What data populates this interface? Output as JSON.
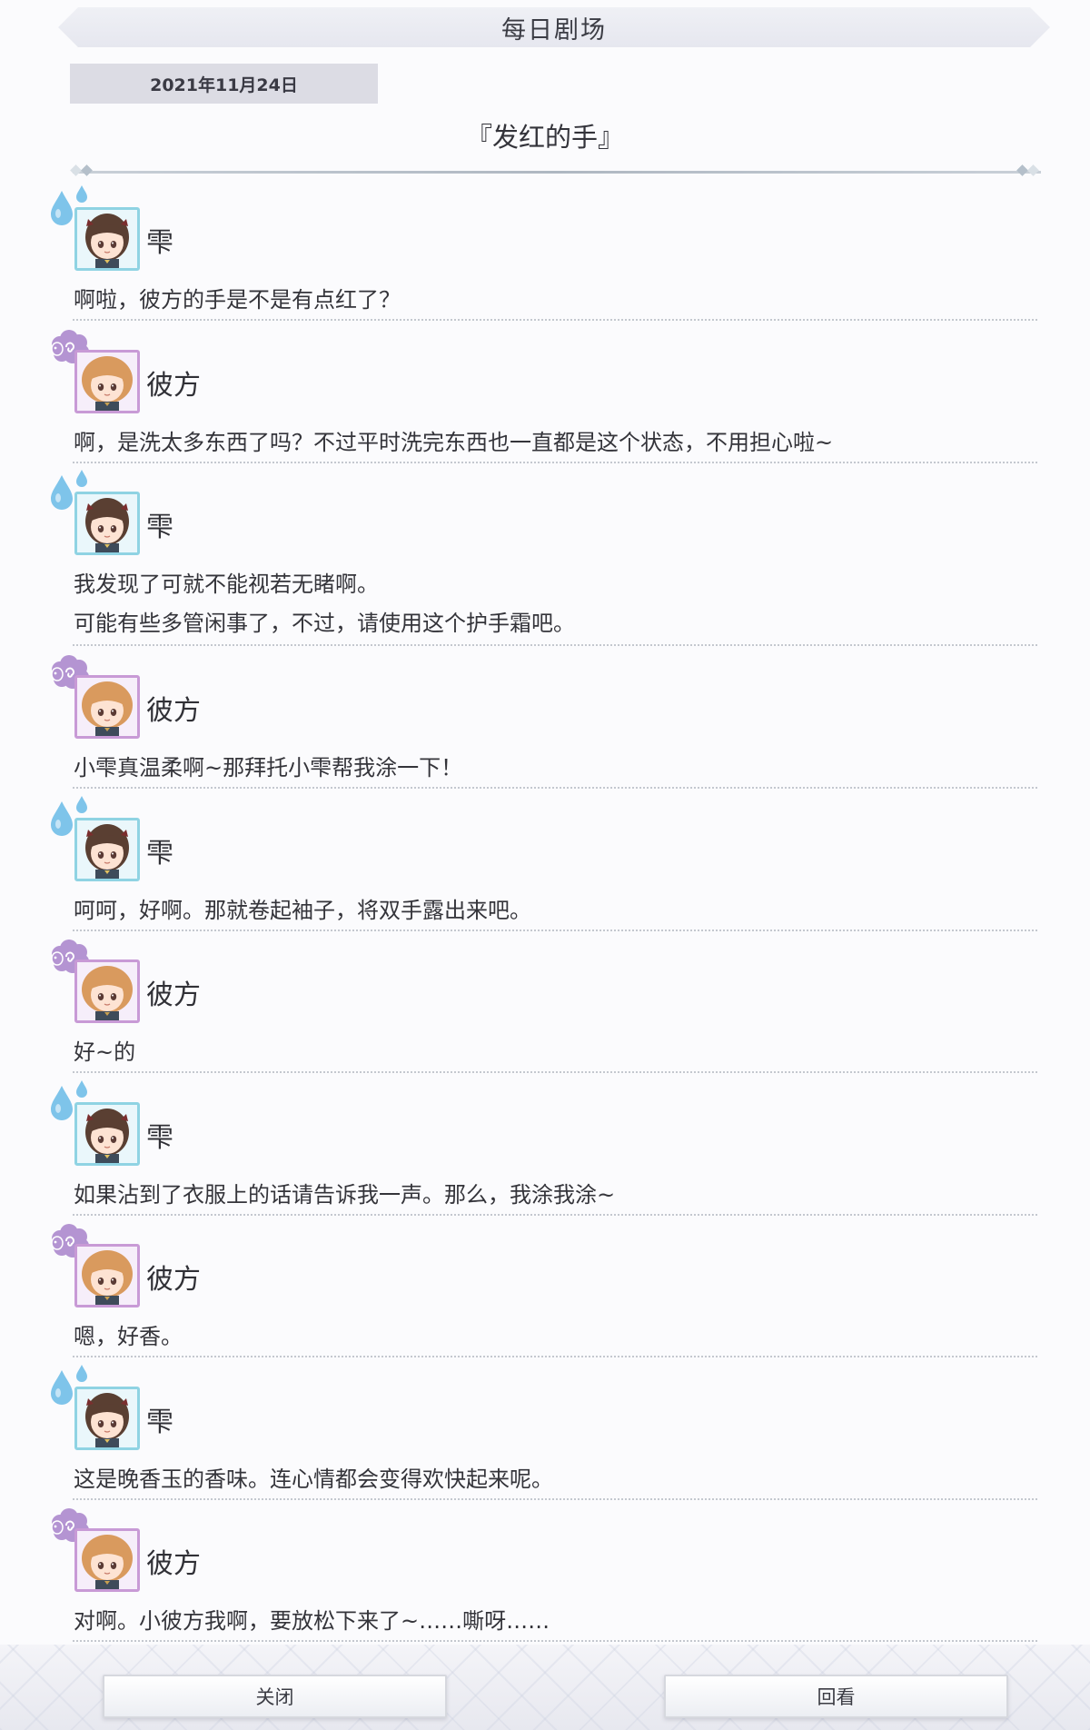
{
  "header": {
    "title": "每日剧场"
  },
  "date": "2021年11月24日",
  "episode_title": "『发红的手』",
  "characters": {
    "shizuku": {
      "name": "雫",
      "frame_color": "#8fd3e3",
      "deco_color": "#7ec4ea",
      "deco_icon": "water-drops-icon"
    },
    "kanata": {
      "name": "彼方",
      "frame_color": "#c89ad6",
      "deco_color": "#b494d2",
      "deco_icon": "sheep-icon"
    }
  },
  "dialogue": [
    {
      "speaker": "雫",
      "lines": [
        "啊啦，彼方的手是不是有点红了？"
      ]
    },
    {
      "speaker": "彼方",
      "lines": [
        "啊，是洗太多东西了吗？不过平时洗完东西也一直都是这个状态，不用担心啦~"
      ]
    },
    {
      "speaker": "雫",
      "lines": [
        "我发现了可就不能视若无睹啊。",
        "可能有些多管闲事了，不过，请使用这个护手霜吧。"
      ]
    },
    {
      "speaker": "彼方",
      "lines": [
        "小雫真温柔啊~那拜托小雫帮我涂一下！"
      ]
    },
    {
      "speaker": "雫",
      "lines": [
        "呵呵，好啊。那就卷起袖子，将双手露出来吧。"
      ]
    },
    {
      "speaker": "彼方",
      "lines": [
        "好~的"
      ]
    },
    {
      "speaker": "雫",
      "lines": [
        "如果沾到了衣服上的话请告诉我一声。那么，我涂我涂~"
      ]
    },
    {
      "speaker": "彼方",
      "lines": [
        "嗯，好香。"
      ]
    },
    {
      "speaker": "雫",
      "lines": [
        "这是晚香玉的香味。连心情都会变得欢快起来呢。"
      ]
    },
    {
      "speaker": "彼方",
      "lines": [
        "对啊。小彼方我啊，要放松下来了~……嘶呀……"
      ]
    }
  ],
  "footer": {
    "close_label": "关闭",
    "log_label": "回看"
  }
}
